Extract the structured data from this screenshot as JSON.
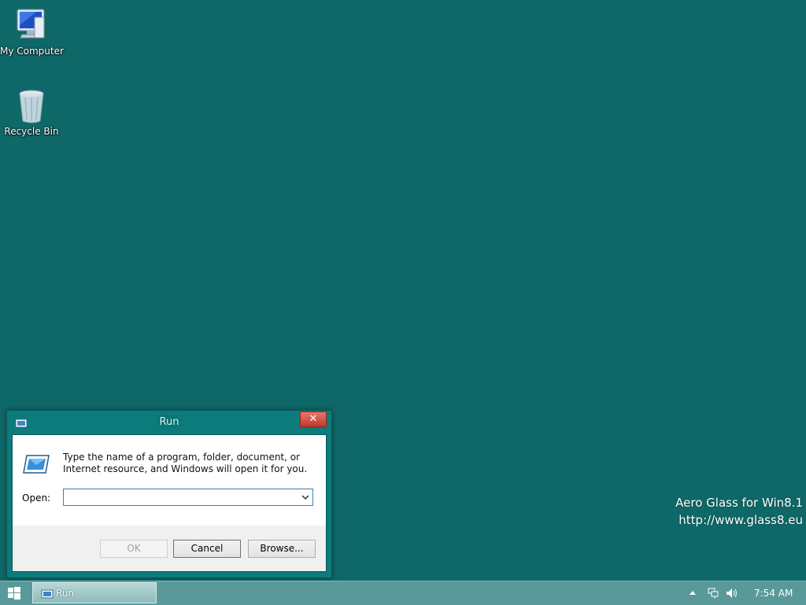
{
  "desktop": {
    "icons": [
      {
        "label": "My Computer",
        "icon": "computer-icon"
      },
      {
        "label": "Recycle Bin",
        "icon": "recycle-bin-icon"
      }
    ],
    "watermark": {
      "line1": "Aero Glass for Win8.1",
      "line2": "http://www.glass8.eu"
    }
  },
  "run_dialog": {
    "title": "Run",
    "close_label": "✕",
    "description": "Type the name of a program, folder, document, or Internet resource, and Windows will open it for you.",
    "open_label": "Open:",
    "open_value": "",
    "buttons": {
      "ok": "OK",
      "cancel": "Cancel",
      "browse": "Browse..."
    }
  },
  "taskbar": {
    "items": [
      {
        "label": "Run",
        "icon": "run-icon",
        "active": true
      }
    ],
    "clock": "7:54 AM"
  },
  "colors": {
    "desktop": "#0f6868",
    "window_frame": "#0c7b7b",
    "taskbar": "#5a9999",
    "close": "#c0392b"
  }
}
